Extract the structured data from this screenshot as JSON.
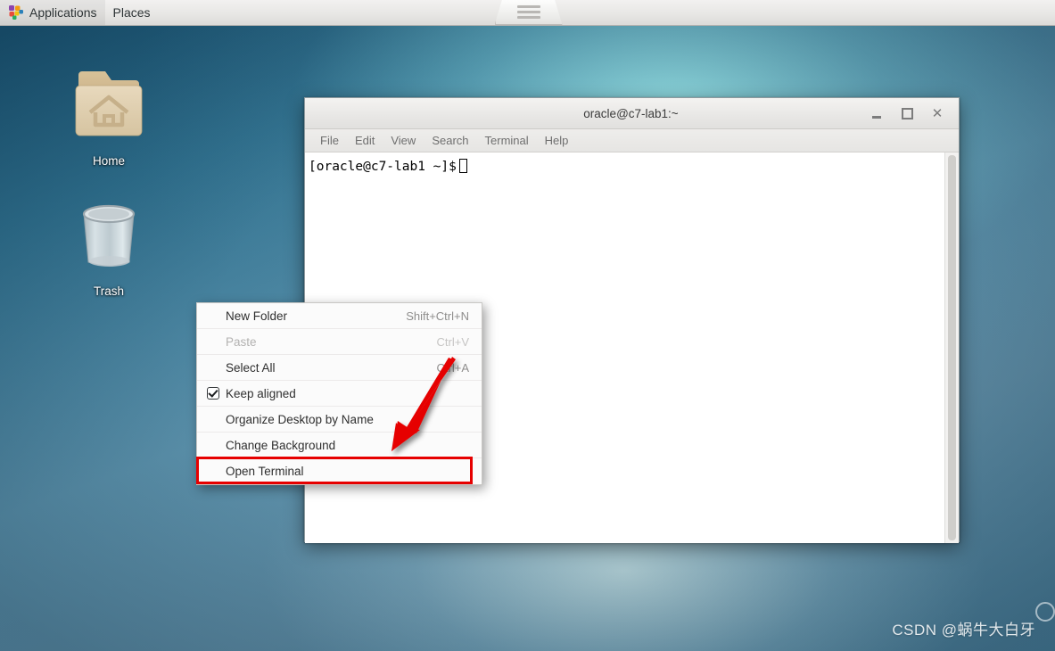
{
  "panel": {
    "applications_label": "Applications",
    "places_label": "Places",
    "apps_icon": "applications-pinwheel-icon",
    "window_tab_icon": "window-list-icon"
  },
  "desktop": {
    "icons": [
      {
        "name": "home",
        "label": "Home",
        "icon": "home-folder-icon"
      },
      {
        "name": "trash",
        "label": "Trash",
        "icon": "trash-bin-icon"
      }
    ]
  },
  "terminal": {
    "title": "oracle@c7-lab1:~",
    "window_buttons": {
      "minimize": "minimize-icon",
      "maximize": "maximize-icon",
      "close": "✕"
    },
    "menubar": [
      "File",
      "Edit",
      "View",
      "Search",
      "Terminal",
      "Help"
    ],
    "prompt": "[oracle@c7-lab1 ~]$"
  },
  "context_menu": {
    "items": [
      {
        "label": "New Folder",
        "accel": "Shift+Ctrl+N",
        "disabled": false,
        "checkbox": false
      },
      {
        "label": "Paste",
        "accel": "Ctrl+V",
        "disabled": true,
        "checkbox": false
      },
      {
        "label": "Select All",
        "accel": "Ctrl+A",
        "disabled": false,
        "checkbox": false
      },
      {
        "label": "Keep aligned",
        "accel": "",
        "disabled": false,
        "checkbox": true,
        "checked": true
      },
      {
        "label": "Organize Desktop by Name",
        "accel": "",
        "disabled": false,
        "checkbox": false
      },
      {
        "label": "Change Background",
        "accel": "",
        "disabled": false,
        "checkbox": false
      },
      {
        "label": "Open Terminal",
        "accel": "",
        "disabled": false,
        "checkbox": false,
        "highlighted": true
      }
    ]
  },
  "annotation": {
    "highlight_color": "#e60000",
    "arrow_color": "#e60000",
    "target_item": "Open Terminal"
  },
  "watermark": {
    "text": "CSDN @蜗牛大白牙"
  }
}
